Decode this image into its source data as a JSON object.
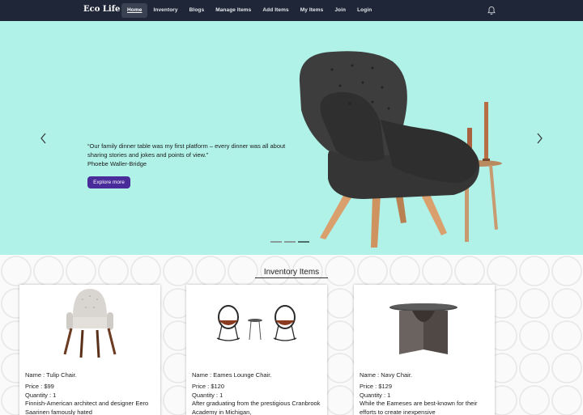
{
  "nav": {
    "brand": "Eco Life",
    "links": [
      "Home",
      "Inventory",
      "Blogs",
      "Manage Items",
      "Add Items",
      "My Items",
      "Join",
      "Login"
    ],
    "active": "Home",
    "icons": {
      "notifications": "bell-icon"
    }
  },
  "hero": {
    "quote": "“Our family dinner table was my first platform – every dinner was all about sharing stories and jokes and points of view.”",
    "author": "Phoebe Waller-Bridge",
    "button": "Explore more",
    "slides": 3,
    "active_slide": 3,
    "background": "#b0f2e8"
  },
  "section": {
    "title": "Inventory Items"
  },
  "items": [
    {
      "name": "Name : Tulip Chair.",
      "price": "Price : $99",
      "quantity": "Quantity : 1",
      "description": "Finnish-American architect and designer Eero Saarinen famously hated"
    },
    {
      "name": "Name : Eames Lounge Chair.",
      "price": "Price : $120",
      "quantity": "Quantity : 1",
      "description": "After graduating from the prestigious Cranbrook Academy in Michigan,"
    },
    {
      "name": "Name : Navy Chair.",
      "price": "Price : $129",
      "quantity": "Quantity : 1",
      "description": "While the Eameses are best-known for their efforts to create inexpensive"
    }
  ],
  "colors": {
    "nav": "#1e2637",
    "button": "#4a2b9a"
  }
}
